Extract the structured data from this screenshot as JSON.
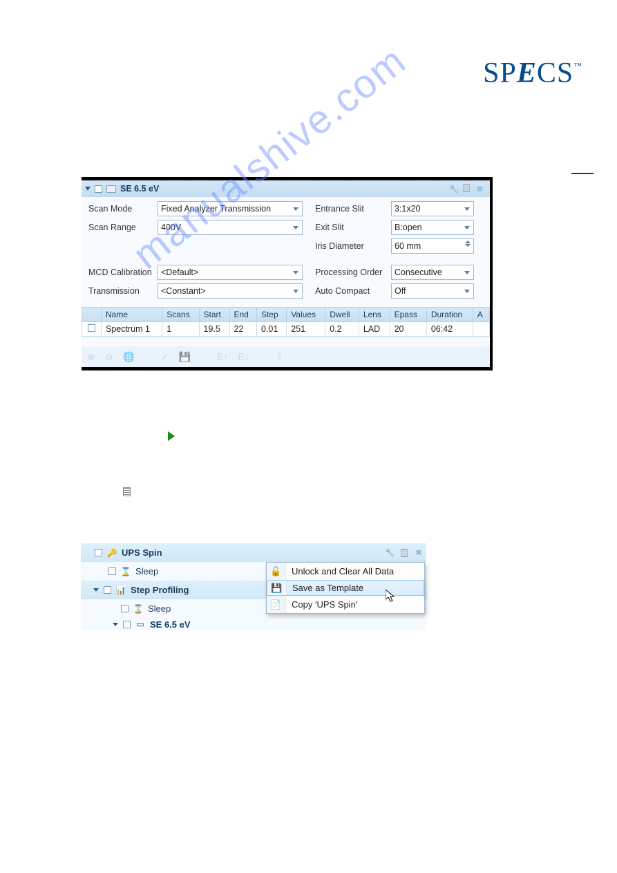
{
  "logo_text": "SP",
  "logo_e": "E",
  "logo_rest": "CS",
  "watermark": "manualshive.com",
  "panel": {
    "title": "SE 6.5 eV",
    "fields": {
      "scan_mode_label": "Scan Mode",
      "scan_mode_value": "Fixed Analyzer Transmission",
      "scan_range_label": "Scan Range",
      "scan_range_value": "400V",
      "entrance_slit_label": "Entrance Slit",
      "entrance_slit_value": "3:1x20",
      "exit_slit_label": "Exit Slit",
      "exit_slit_value": "B:open",
      "iris_label": "Iris Diameter",
      "iris_value": "60 mm",
      "mcd_label": "MCD Calibration",
      "mcd_value": "<Default>",
      "transmission_label": "Transmission",
      "transmission_value": "<Constant>",
      "proc_order_label": "Processing Order",
      "proc_order_value": "Consecutive",
      "auto_compact_label": "Auto Compact",
      "auto_compact_value": "Off"
    },
    "table": {
      "headers": [
        "",
        "Name",
        "Scans",
        "Start",
        "End",
        "Step",
        "Values",
        "Dwell",
        "Lens",
        "Epass",
        "Duration",
        "A"
      ],
      "row": {
        "name": "Spectrum 1",
        "scans": "1",
        "start": "19.5",
        "end": "22",
        "step": "0.01",
        "values": "251",
        "dwell": "0.2",
        "lens": "LAD",
        "epass": "20",
        "duration": "06:42"
      }
    }
  },
  "tree": {
    "items": [
      {
        "label": "UPS Spin",
        "bold": true
      },
      {
        "label": "Sleep",
        "child": true
      },
      {
        "label": "Step Profiling",
        "bold": true
      },
      {
        "label": "Sleep",
        "child": true
      },
      {
        "label": "SE 6.5 eV",
        "child": true,
        "cut": true
      }
    ]
  },
  "context_menu": {
    "items": [
      {
        "label": "Unlock and Clear All Data",
        "disabled": true
      },
      {
        "label": "Save as Template",
        "highlight": true
      },
      {
        "label": "Copy 'UPS Spin'"
      }
    ]
  }
}
